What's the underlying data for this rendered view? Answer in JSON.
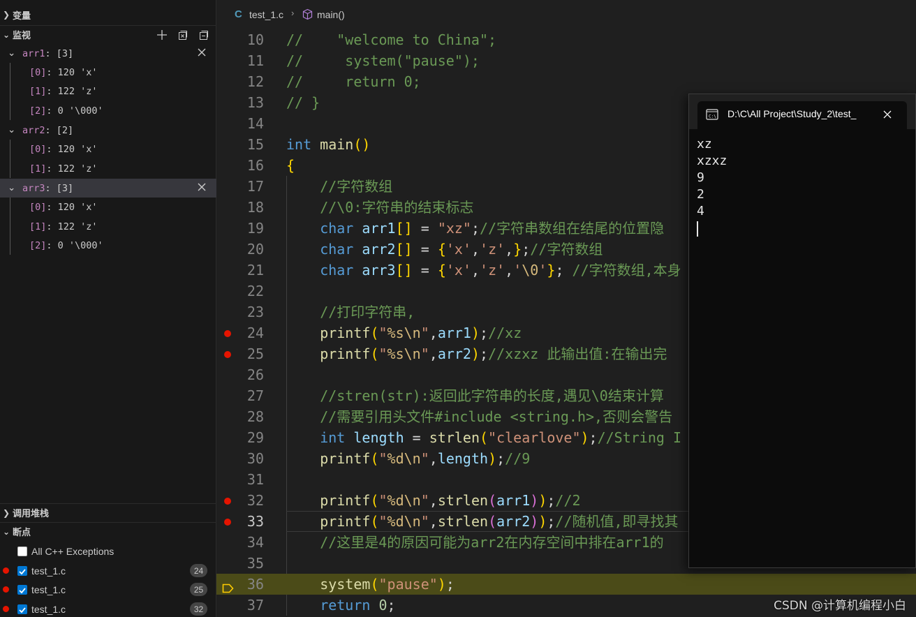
{
  "sidebar": {
    "variables_title": "变量",
    "watch_title": "监视",
    "watch": [
      {
        "name": "arr1",
        "value": "[3]",
        "children": [
          {
            "name": "[0]",
            "value": "120 'x'"
          },
          {
            "name": "[1]",
            "value": "122 'z'"
          },
          {
            "name": "[2]",
            "value": "0 '\\000'"
          }
        ]
      },
      {
        "name": "arr2",
        "value": "[2]",
        "children": [
          {
            "name": "[0]",
            "value": "120 'x'"
          },
          {
            "name": "[1]",
            "value": "122 'z'"
          }
        ]
      },
      {
        "name": "arr3",
        "value": "[3]",
        "children": [
          {
            "name": "[0]",
            "value": "120 'x'"
          },
          {
            "name": "[1]",
            "value": "122 'z'"
          },
          {
            "name": "[2]",
            "value": "0 '\\000'"
          }
        ]
      }
    ],
    "callstack_title": "调用堆栈",
    "breakpoints_title": "断点",
    "breakpoints": [
      {
        "label": "All C++ Exceptions",
        "checked": false,
        "count": ""
      },
      {
        "label": "test_1.c",
        "checked": true,
        "count": "24"
      },
      {
        "label": "test_1.c",
        "checked": true,
        "count": "25"
      },
      {
        "label": "test_1.c",
        "checked": true,
        "count": "32"
      }
    ]
  },
  "editor": {
    "breadcrumb": {
      "file": "test_1.c",
      "function": "main()"
    },
    "lines": [
      {
        "n": "10",
        "text": "//    \"welcome to China\";"
      },
      {
        "n": "11",
        "text": "//     system(\"pause\");"
      },
      {
        "n": "12",
        "text": "//     return 0;"
      },
      {
        "n": "13",
        "text": "// }"
      },
      {
        "n": "14",
        "text": ""
      },
      {
        "n": "15",
        "text": "int main()"
      },
      {
        "n": "16",
        "text": "{"
      },
      {
        "n": "17",
        "text": "    //字符数组"
      },
      {
        "n": "18",
        "text": "    //\\0:字符串的结束标志"
      },
      {
        "n": "19",
        "text": "    char arr1[] = \"xz\";//字符串数组在结尾的位置隐"
      },
      {
        "n": "20",
        "text": "    char arr2[] = {'x','z',};//字符数组"
      },
      {
        "n": "21",
        "text": "    char arr3[] = {'x','z','\\0'}; //字符数组,本身"
      },
      {
        "n": "22",
        "text": ""
      },
      {
        "n": "23",
        "text": "    //打印字符串,"
      },
      {
        "n": "24",
        "text": "    printf(\"%s\\n\",arr1);//xz"
      },
      {
        "n": "25",
        "text": "    printf(\"%s\\n\",arr2);//xzxz 此输出值:在输出完"
      },
      {
        "n": "26",
        "text": ""
      },
      {
        "n": "27",
        "text": "    //stren(str):返回此字符串的长度,遇见\\0结束计算"
      },
      {
        "n": "28",
        "text": "    //需要引用头文件#include <string.h>,否则会警告"
      },
      {
        "n": "29",
        "text": "    int length = strlen(\"clearlove\");//String I"
      },
      {
        "n": "30",
        "text": "    printf(\"%d\\n\",length);//9"
      },
      {
        "n": "31",
        "text": ""
      },
      {
        "n": "32",
        "text": "    printf(\"%d\\n\",strlen(arr1));//2"
      },
      {
        "n": "33",
        "text": "    printf(\"%d\\n\",strlen(arr2));//随机值,即寻找其"
      },
      {
        "n": "34",
        "text": "    //这里是4的原因可能为arr2在内存空间中排在arr1的"
      },
      {
        "n": "35",
        "text": ""
      },
      {
        "n": "36",
        "text": "    system(\"pause\");"
      },
      {
        "n": "37",
        "text": "    return 0;"
      }
    ]
  },
  "terminal": {
    "title": "D:\\C\\All Project\\Study_2\\test_",
    "output": [
      "xz",
      "xzxz",
      "9",
      "2",
      "4"
    ]
  },
  "watermark": "CSDN @计算机编程小白",
  "colors": {
    "breakpoint": "#e51400",
    "current_line": "#4b4b18",
    "accent": "#0078d4"
  }
}
